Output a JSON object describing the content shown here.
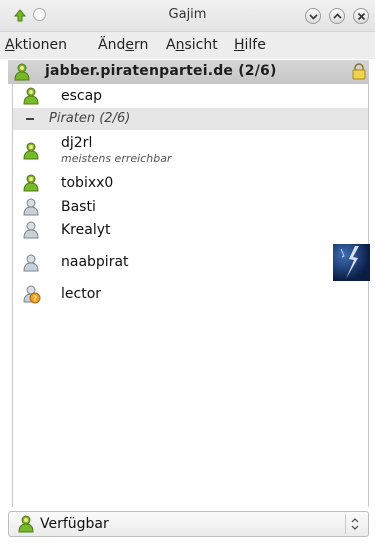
{
  "window": {
    "title": "Gajim"
  },
  "menu": {
    "items": [
      {
        "pre": "",
        "u": "A",
        "post": "ktionen"
      },
      {
        "pre": "Änd",
        "u": "e",
        "post": "rn"
      },
      {
        "pre": "A",
        "u": "n",
        "post": "sicht"
      },
      {
        "pre": "",
        "u": "H",
        "post": "ilfe"
      }
    ]
  },
  "account": {
    "label": "jabber.piratenpartei.de (2/6)"
  },
  "contacts_top": [
    {
      "name": "escap",
      "status": "online"
    }
  ],
  "group": {
    "label": "Piraten (2/6)"
  },
  "contacts": [
    {
      "name": "dj2rl",
      "status_msg": "meistens erreichbar",
      "status": "online"
    },
    {
      "name": "tobixx0",
      "status": "online"
    },
    {
      "name": "Basti",
      "status": "offline"
    },
    {
      "name": "Krealyt",
      "status": "offline"
    },
    {
      "name": "naabpirat",
      "status": "offline"
    },
    {
      "name": "lector",
      "status": "requested"
    }
  ],
  "status_selector": {
    "value": "Verfügbar"
  },
  "colors": {
    "online": "#6bb42a",
    "offline": "#b8c0c8",
    "requested": "#e0a020",
    "accent": "#1a1a1a"
  }
}
